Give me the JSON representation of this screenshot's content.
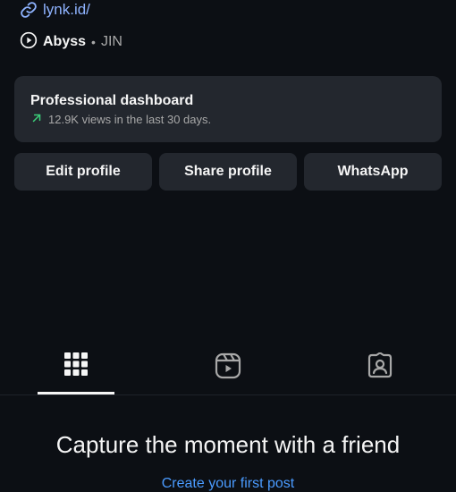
{
  "profile": {
    "link_text": "lynk.id/",
    "music": {
      "title": "Abyss",
      "separator": "•",
      "artist": "JIN"
    }
  },
  "dashboard": {
    "title": "Professional dashboard",
    "subtitle": "12.9K views in the last 30 days.",
    "arrow_color": "#3ccf7a"
  },
  "actions": {
    "edit_label": "Edit profile",
    "share_label": "Share profile",
    "whatsapp_label": "WhatsApp"
  },
  "tabs": [
    {
      "name": "grid",
      "icon": "grid-icon",
      "active": true
    },
    {
      "name": "reels",
      "icon": "reels-icon",
      "active": false
    },
    {
      "name": "tagged",
      "icon": "tagged-icon",
      "active": false
    }
  ],
  "empty_state": {
    "title": "Capture the moment with a friend",
    "cta": "Create your first post"
  },
  "colors": {
    "background": "#0c0f14",
    "card": "#23272e",
    "link": "#8fb3ff",
    "cta": "#4a9bff"
  }
}
